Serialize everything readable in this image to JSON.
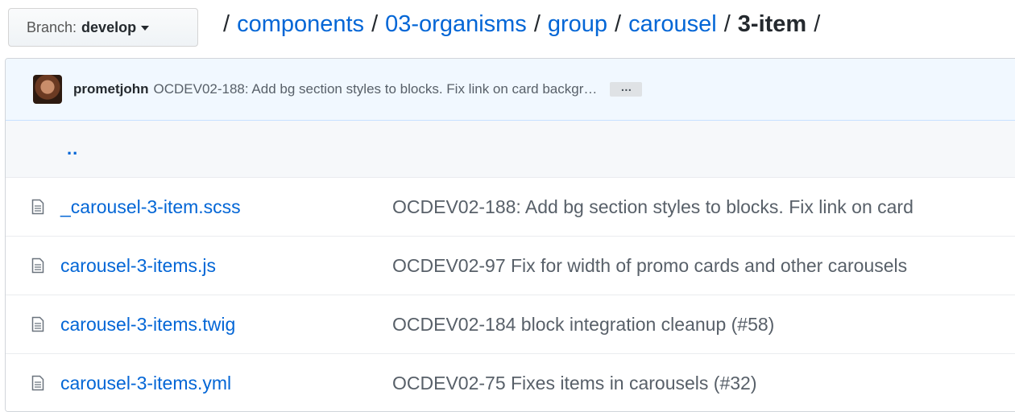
{
  "branch": {
    "label": "Branch:",
    "value": "develop"
  },
  "breadcrumb": {
    "links": [
      "components",
      "03-organisms",
      "group",
      "carousel"
    ],
    "current": "3-item",
    "separator": "/"
  },
  "latest_commit": {
    "author": "prometjohn",
    "message": "OCDEV02-188: Add bg section styles to blocks. Fix link on card backgr…",
    "more": "…"
  },
  "parent_dir": "..",
  "files": [
    {
      "name": "_carousel-3-item.scss",
      "message": "OCDEV02-188: Add bg section styles to blocks. Fix link on card",
      "icon": "file-icon"
    },
    {
      "name": "carousel-3-items.js",
      "message": "OCDEV02-97 Fix for width of promo cards and other carousels",
      "icon": "file-icon"
    },
    {
      "name": "carousel-3-items.twig",
      "message": "OCDEV02-184 block integration cleanup (#58)",
      "icon": "file-icon"
    },
    {
      "name": "carousel-3-items.yml",
      "message": "OCDEV02-75 Fixes items in carousels (#32)",
      "icon": "file-icon"
    }
  ],
  "colors": {
    "link": "#0366d6",
    "commit_bar": "#f1f8ff",
    "muted": "#586069"
  }
}
